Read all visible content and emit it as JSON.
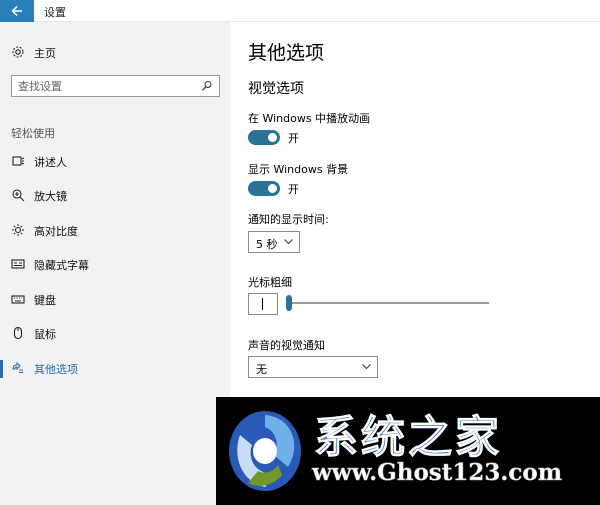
{
  "window": {
    "title": "设置"
  },
  "sidebar": {
    "home_label": "主页",
    "search_placeholder": "查找设置",
    "section_label": "轻松使用",
    "items": [
      {
        "label": "讲述人",
        "icon": "narrator-icon"
      },
      {
        "label": "放大镜",
        "icon": "magnifier-icon"
      },
      {
        "label": "高对比度",
        "icon": "contrast-icon"
      },
      {
        "label": "隐藏式字幕",
        "icon": "captions-icon"
      },
      {
        "label": "键盘",
        "icon": "keyboard-icon"
      },
      {
        "label": "鼠标",
        "icon": "mouse-icon"
      },
      {
        "label": "其他选项",
        "icon": "other-options-icon",
        "selected": true
      }
    ]
  },
  "main": {
    "title": "其他选项",
    "section": "视觉选项",
    "animations": {
      "label": "在 Windows 中播放动画",
      "state": "开",
      "on": true
    },
    "background": {
      "label": "显示 Windows 背景",
      "state": "开",
      "on": true
    },
    "notification": {
      "label": "通知的显示时间:",
      "value": "5 秒"
    },
    "cursor": {
      "label": "光标粗细",
      "level": 1
    },
    "sound": {
      "label": "声音的视觉通知",
      "value": "无"
    }
  },
  "watermark": {
    "cn": "系统之家",
    "url": "www.Ghost123.com"
  },
  "colors": {
    "accent": "#2b6aa8",
    "toggle": "#2a7297",
    "back_button": "#2b7fb8",
    "sidebar_bg": "#f2f2f2"
  }
}
